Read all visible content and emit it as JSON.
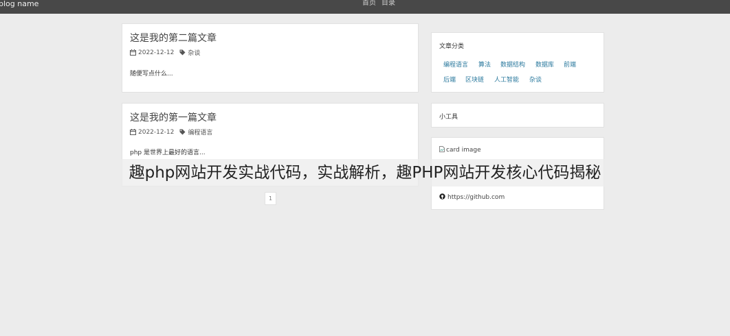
{
  "header": {
    "brand": "blog name",
    "nav": [
      "首页",
      "目录"
    ]
  },
  "posts": [
    {
      "title": "这是我的第二篇文章",
      "date": "2022-12-12",
      "tag": "杂谈",
      "excerpt": "随便写点什么..."
    },
    {
      "title": "这是我的第一篇文章",
      "date": "2022-12-12",
      "tag": "编程语言",
      "excerpt": "php 是世界上最好的语言..."
    }
  ],
  "pagination": {
    "current": "1"
  },
  "sidebar": {
    "categories": {
      "title": "文章分类",
      "items": [
        "编程语言",
        "算法",
        "数据结构",
        "数据库",
        "前端",
        "后端",
        "区块链",
        "人工智能",
        "杂谈"
      ]
    },
    "tools": {
      "title": "小工具"
    },
    "card": {
      "image_alt": "card image",
      "link": "https://github.com"
    }
  },
  "overlay_caption": "趣php网站开发实战代码，实战解析，趣PHP网站开发核心代码揭秘",
  "colors": {
    "topbar": "#484848",
    "background": "#ececec",
    "category_link": "#2c7a9e"
  },
  "icons": {
    "date": "calendar-icon",
    "tag": "tag-icon",
    "image": "broken-image-icon",
    "link": "github-icon"
  }
}
